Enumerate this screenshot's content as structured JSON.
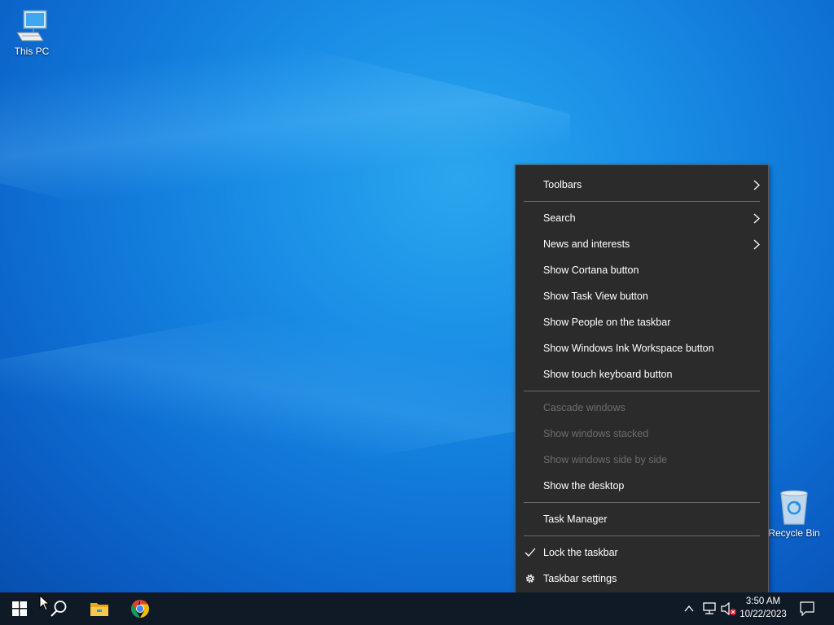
{
  "desktop": {
    "icons": [
      {
        "label": "This PC"
      },
      {
        "label": "Recycle Bin"
      }
    ]
  },
  "context_menu": {
    "items": {
      "toolbars": "Toolbars",
      "search": "Search",
      "news": "News and interests",
      "cortana": "Show Cortana button",
      "task_view": "Show Task View button",
      "people": "Show People on the taskbar",
      "ink": "Show Windows Ink Workspace button",
      "touch_keyboard": "Show touch keyboard button",
      "cascade": "Cascade windows",
      "stacked": "Show windows stacked",
      "side_by_side": "Show windows side by side",
      "show_desktop": "Show the desktop",
      "task_manager": "Task Manager",
      "lock": "Lock the taskbar",
      "settings": "Taskbar settings"
    }
  },
  "taskbar": {
    "clock_time": "3:50 AM",
    "clock_date": "10/22/2023"
  },
  "icons": {
    "start": "windows-logo-icon",
    "search": "search-icon",
    "explorer": "folder-icon",
    "chrome": "chrome-icon"
  },
  "colors": {
    "menu_bg": "#2b2b2b",
    "taskbar_bg": "#0f1a26",
    "disabled_text": "#6d6d6d"
  }
}
